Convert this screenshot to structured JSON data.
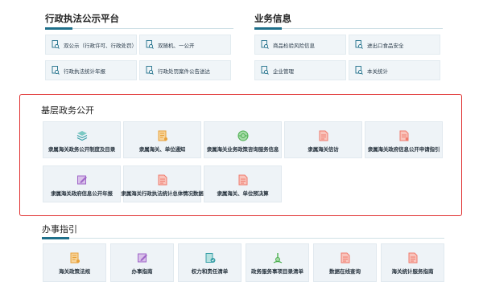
{
  "sections": {
    "law": {
      "title": "行政执法公示平台",
      "links": [
        {
          "label": "双公示（行政许可、行政处罚）",
          "icon": "document-search-icon"
        },
        {
          "label": "双随机、一公开",
          "icon": "document-search-icon"
        },
        {
          "label": "行政执法统计年报",
          "icon": "document-search-icon"
        },
        {
          "label": "行政处罚案件公告送达",
          "icon": "document-search-icon"
        }
      ]
    },
    "business": {
      "title": "业务信息",
      "links": [
        {
          "label": "商品检验风险信息",
          "icon": "document-search-icon"
        },
        {
          "label": "进出口食品安全",
          "icon": "document-search-icon"
        },
        {
          "label": "企业管理",
          "icon": "document-search-icon"
        },
        {
          "label": "本关统计",
          "icon": "document-search-icon"
        }
      ]
    },
    "grassroots": {
      "title": "基层政务公开",
      "tiles": [
        {
          "label": "隶属海关政务公开制度及目录",
          "icon": "stack-layers-icon",
          "color": "#3aa0a8"
        },
        {
          "label": "隶属海关、单位通知",
          "icon": "notice-document-icon",
          "color": "#e8a13a"
        },
        {
          "label": "隶属海关业务政策咨询服务信息",
          "icon": "consult-service-icon",
          "color": "#4caf50"
        },
        {
          "label": "隶属海关信访",
          "icon": "petition-document-icon",
          "color": "#ef7a6c"
        },
        {
          "label": "隶属海关政府信息公开申请指引",
          "icon": "application-document-icon",
          "color": "#ef7a6c"
        },
        {
          "label": "隶属海关政府信息公开年报",
          "icon": "edit-report-icon",
          "color": "#a067c8"
        },
        {
          "label": "隶属海关行政执法统计总体情况数据",
          "icon": "statistics-document-icon",
          "color": "#ef7a6c"
        },
        {
          "label": "隶属海关、单位预决算",
          "icon": "budget-document-icon",
          "color": "#ef7a6c"
        }
      ]
    },
    "guide": {
      "title": "办事指引",
      "tiles": [
        {
          "label": "海关政策法规",
          "icon": "policy-document-icon",
          "color": "#e8a13a"
        },
        {
          "label": "办事指南",
          "icon": "guide-edit-icon",
          "color": "#a067c8"
        },
        {
          "label": "权力和责任清单",
          "icon": "rights-checklist-icon",
          "color": "#3aa0a8"
        },
        {
          "label": "政务服务事项目录清单",
          "icon": "service-catalog-icon",
          "color": "#4caf50"
        },
        {
          "label": "数据在线查询",
          "icon": "data-query-icon",
          "color": "#ef7a6c"
        },
        {
          "label": "海关统计服务指南",
          "icon": "statistics-guide-icon",
          "color": "#ef7a6c"
        }
      ]
    }
  },
  "colors": {
    "accent": "#1e6f8a",
    "highlight_frame": "#e03030"
  }
}
